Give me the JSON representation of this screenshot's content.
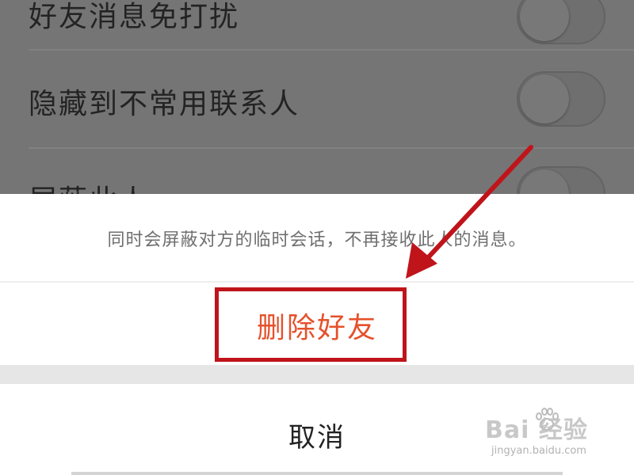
{
  "settings": {
    "items": [
      {
        "label": "好友消息免打扰"
      },
      {
        "label": "隐藏到不常用联系人"
      },
      {
        "label": "屏蔽此人"
      }
    ]
  },
  "action_sheet": {
    "message": "同时会屏蔽对方的临时会话，不再接收此人的消息。",
    "delete_label": "删除好友",
    "cancel_label": "取消"
  },
  "annotation": {
    "color": "#c0141b"
  },
  "watermark": {
    "logo": "Bai 经验",
    "url": "jingyan.baidu.com"
  },
  "colors": {
    "destructive": "#e5512b",
    "overlay": "#7d7d7d"
  }
}
